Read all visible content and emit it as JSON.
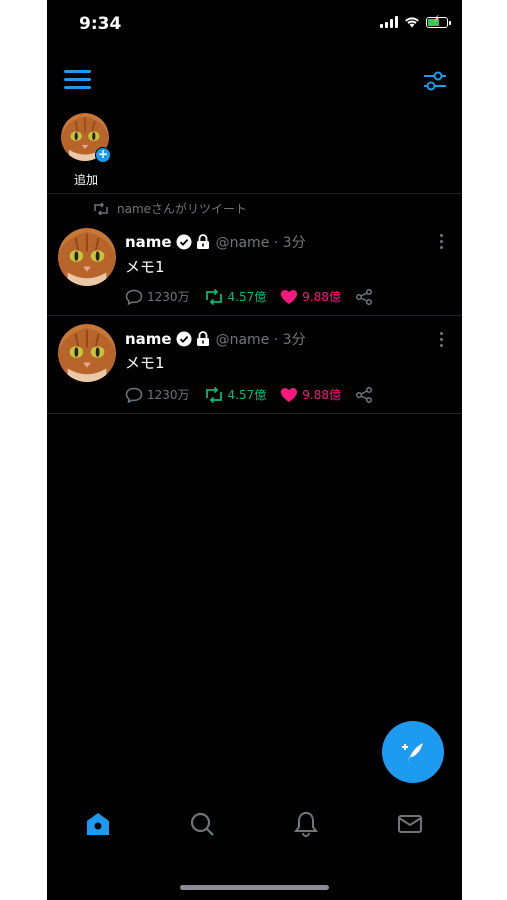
{
  "status_bar": {
    "time": "9:34"
  },
  "story": {
    "label": "追加"
  },
  "tweets": [
    {
      "retweeted_by": "nameさんがリツイート",
      "name": "name",
      "handle": "@name · 3分",
      "text": "メモ1",
      "replies": "1230万",
      "retweets": "4.57億",
      "likes": "9.88億"
    },
    {
      "name": "name",
      "handle": "@name · 3分",
      "text": "メモ1",
      "replies": "1230万",
      "retweets": "4.57億",
      "likes": "9.88億"
    }
  ],
  "colors": {
    "accent": "#1d9bf0",
    "retweet": "#00ba7c",
    "like": "#f91880",
    "secondary_text": "#71767b",
    "background": "#000000"
  },
  "icons": [
    "menu-icon",
    "filter-icon",
    "verified-icon",
    "lock-icon",
    "retweet-icon",
    "reply-icon",
    "heart-icon",
    "share-icon",
    "more-icon",
    "compose-icon",
    "home-icon",
    "search-icon",
    "bell-icon",
    "mail-icon"
  ]
}
